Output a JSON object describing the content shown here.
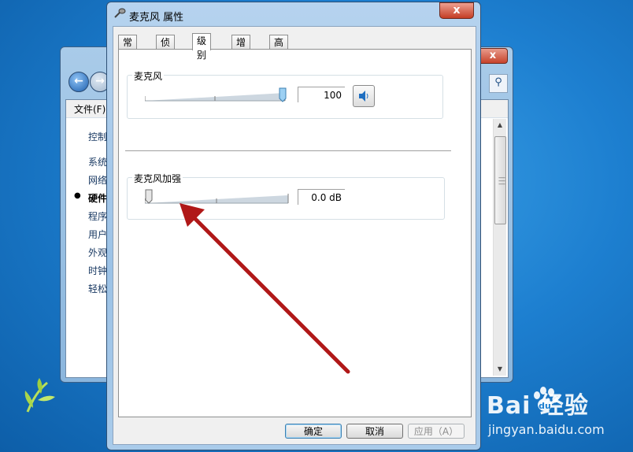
{
  "dialog": {
    "title": "麦克风 属性",
    "close_label": "x",
    "tabs": [
      {
        "label": "常规"
      },
      {
        "label": "侦听"
      },
      {
        "label": "级别"
      },
      {
        "label": "增强"
      },
      {
        "label": "高级"
      }
    ],
    "active_tab": "级别",
    "mic_group": {
      "label": "麦克风",
      "value": "100",
      "level": 1.0
    },
    "boost_group": {
      "label": "麦克风加强",
      "value": "0.0 dB",
      "level": 0.0
    },
    "buttons": {
      "ok": "确定",
      "cancel": "取消",
      "apply": "应用（A）"
    }
  },
  "back_window": {
    "close_label": "x",
    "menu_file": "文件(F)",
    "nav_items": [
      {
        "label": "控制"
      },
      {
        "label": "系统"
      },
      {
        "label": "网络"
      },
      {
        "label": "硬件"
      },
      {
        "label": "程序"
      },
      {
        "label": "用户"
      },
      {
        "label": "外观"
      },
      {
        "label": "时钟"
      },
      {
        "label": "轻松"
      }
    ],
    "active_nav": "硬件"
  },
  "watermark": {
    "logo": "Bai  经验",
    "url": "jingyan.baidu.com"
  },
  "colors": {
    "arrow": "#b01818",
    "accent": "#3c7fb1",
    "desktop": "#1d7fd0"
  }
}
